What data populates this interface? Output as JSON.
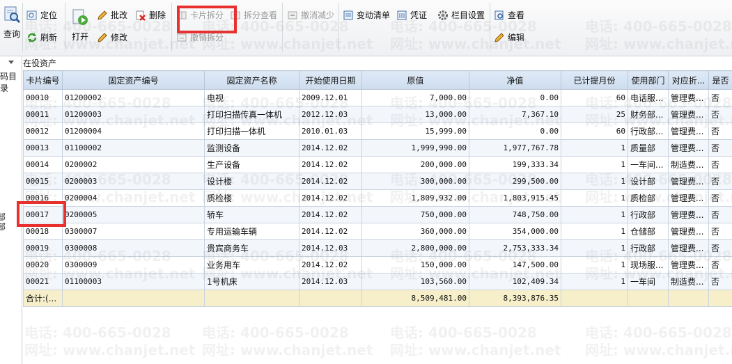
{
  "toolbar": {
    "query": "查询",
    "locate": "定位",
    "refresh": "刷新",
    "open": "打开",
    "batch_edit": "批改",
    "edit": "修改",
    "delete": "删除",
    "card_split": "卡片拆分",
    "undo_split": "撤销拆分",
    "split_view": "拆分查看",
    "undo_reduce": "撤消减少",
    "change_list": "变动清单",
    "voucher": "凭证",
    "column_settings": "栏目设置",
    "view": "查看",
    "edit2": "编辑"
  },
  "left_panel": {
    "label_top": "码目录",
    "label_side": "部部"
  },
  "grid": {
    "title": "在役资产",
    "columns": [
      "卡片编号",
      "固定资产编号",
      "固定资产名称",
      "开始使用日期",
      "原值",
      "净值",
      "已计提月份",
      "使用部门",
      "对应折...",
      "是否"
    ],
    "rows": [
      [
        "00010",
        "01200002",
        "电视",
        "2009.12.01",
        "7,000.00",
        "0.00",
        "60",
        "电话服...",
        "管理费...",
        "否"
      ],
      [
        "00011",
        "01200003",
        "打印扫描传真一体机",
        "2012.12.03",
        "13,000.00",
        "7,367.10",
        "25",
        "财务部...",
        "管理费...",
        "否"
      ],
      [
        "00012",
        "01200004",
        "打印扫描一体机",
        "2010.01.03",
        "15,999.00",
        "0.00",
        "60",
        "行政部...",
        "管理费...",
        "否"
      ],
      [
        "00013",
        "01100002",
        "监测设备",
        "2014.12.02",
        "1,999,990.00",
        "1,977,767.78",
        "1",
        "质量部",
        "管理费...",
        "否"
      ],
      [
        "00014",
        "0200002",
        "生产设备",
        "2014.12.02",
        "200,000.00",
        "199,333.34",
        "1",
        "一车间...",
        "制造费...",
        "否"
      ],
      [
        "00015",
        "0200003",
        "设计楼",
        "2014.12.02",
        "300,000.00",
        "299,500.00",
        "1",
        "设计部",
        "管理费...",
        "否"
      ],
      [
        "00016",
        "0200004",
        "质检楼",
        "2014.12.02",
        "1,809,932.00",
        "1,803,915.45",
        "1",
        "质检部",
        "管理费...",
        "否"
      ],
      [
        "00017",
        "0200005",
        "轿车",
        "2014.12.02",
        "750,000.00",
        "748,750.00",
        "1",
        "行政部",
        "管理费...",
        "否"
      ],
      [
        "00018",
        "0300007",
        "专用运输车辆",
        "2014.12.02",
        "360,000.00",
        "354,000.00",
        "1",
        "仓储部",
        "管理费...",
        "否"
      ],
      [
        "00019",
        "0300008",
        "贵宾商务车",
        "2014.12.03",
        "2,800,000.00",
        "2,753,333.34",
        "1",
        "行政部",
        "管理费...",
        "否"
      ],
      [
        "00020",
        "0300009",
        "业务用车",
        "2014.12.02",
        "150,000.00",
        "147,500.00",
        "1",
        "现场服...",
        "管理费...",
        "否"
      ],
      [
        "00021",
        "01100003",
        "1号机床",
        "2014.12.03",
        "103,560.00",
        "102,409.34",
        "1",
        "一车间",
        "制造费...",
        "否"
      ]
    ],
    "summary": [
      "合计:(...",
      "",
      "",
      "",
      "8,509,481.00",
      "8,393,876.35",
      "",
      "",
      "",
      ""
    ]
  },
  "watermark": {
    "phone": "电话: 400-665-0028",
    "site": "网址: www.chanjet.net"
  },
  "colors": {
    "highlight": "#e8302f",
    "header_bg": "#dfeaf7",
    "summary_bg": "#f6efc9"
  }
}
